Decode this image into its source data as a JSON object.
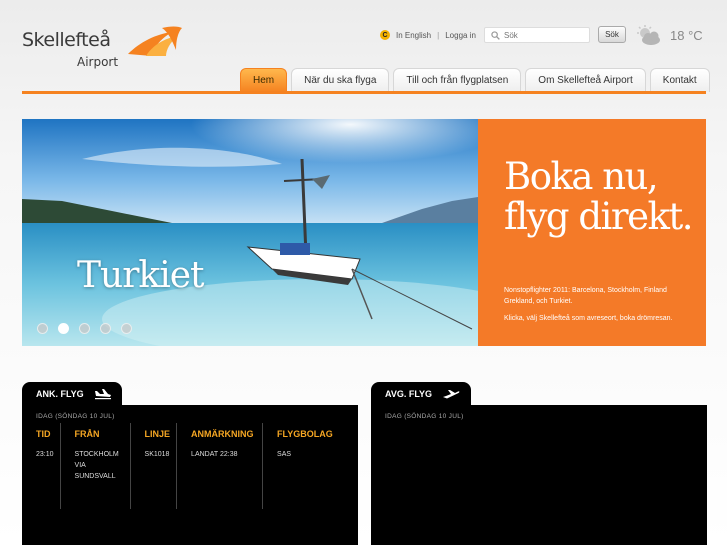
{
  "header": {
    "logo_name": "Skellefteå",
    "logo_sub": "Airport",
    "lang_icon": "C",
    "lang_link": "In English",
    "login_link": "Logga in",
    "search_placeholder": "Sök",
    "search_button": "Sök",
    "weather_icon": "partly-cloudy-icon",
    "temperature": "18 °C"
  },
  "nav": {
    "tabs": [
      {
        "label": "Hem",
        "active": true
      },
      {
        "label": "När du ska flyga",
        "active": false
      },
      {
        "label": "Till och från flygplatsen",
        "active": false
      },
      {
        "label": "Om Skellefteå Airport",
        "active": false
      },
      {
        "label": "Kontakt",
        "active": false
      }
    ]
  },
  "banner": {
    "destination": "Turkiet",
    "headline_line1": "Boka nu,",
    "headline_line2": "flyg direkt.",
    "text1": "Nonstopflighter 2011: Barcelona, Stockholm, Finland Grekland, och Turkiet.",
    "text2": "Klicka, välj Skellefteå som avreseort, boka drömresan.",
    "slide_count": 5,
    "active_slide": 2
  },
  "arrivals": {
    "title": "ANK. FLYG",
    "date": "IDAG (SÖNDAG 10 JUL)",
    "columns": [
      "TID",
      "FRÅN",
      "LINJE",
      "ANMÄRKNING",
      "FLYGBOLAG"
    ],
    "rows": [
      {
        "tid": "23:10",
        "fran": "STOCKHOLM\nVIA\nSUNDSVALL",
        "linje": "SK1018",
        "anmarkning": "LANDAT 22:38",
        "flygbolag": "SAS"
      }
    ]
  },
  "departures": {
    "title": "AVG. FLYG",
    "date": "IDAG (SÖNDAG 10 JUL)"
  },
  "colors": {
    "brand_orange": "#f58220",
    "promo_orange": "#f47a28",
    "header_gold": "#f5a623",
    "panel_black": "#000000"
  }
}
